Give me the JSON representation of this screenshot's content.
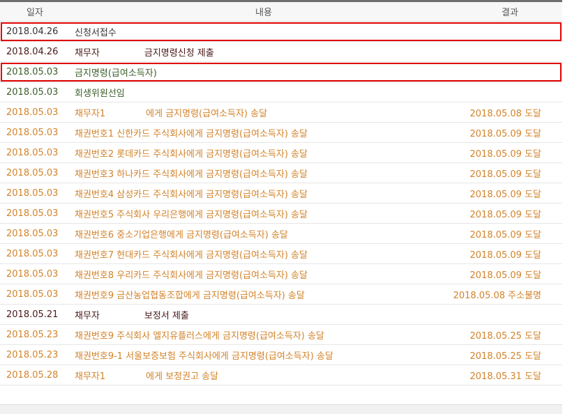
{
  "header": {
    "date": "일자",
    "content": "내용",
    "result": "결과"
  },
  "rows": [
    {
      "date": "2018.04.26",
      "party": "신청서접수",
      "text": "",
      "result": "",
      "color": "#333333",
      "highlighted": true
    },
    {
      "date": "2018.04.26",
      "party": "채무자",
      "text": "금지명령신청 제출",
      "result": "",
      "color": "#4a1818",
      "highlighted": false
    },
    {
      "date": "2018.05.03",
      "party": "금지명령(급여소득자)",
      "text": "",
      "result": "",
      "color": "#3b5e2a",
      "highlighted": true
    },
    {
      "date": "2018.05.03",
      "party": "회생위원선임",
      "text": "",
      "result": "",
      "color": "#3b5e2a",
      "highlighted": false
    },
    {
      "date": "2018.05.03",
      "party": "채무자1",
      "text": "에게 금지명령(급여소득자) 송달",
      "result": "2018.05.08 도달",
      "color": "#d2832a",
      "highlighted": false
    },
    {
      "date": "2018.05.03",
      "party": "채권번호1 신한카드 주식회사에게 금지명령(급여소득자) 송달",
      "text": "",
      "result": "2018.05.09 도달",
      "color": "#d2832a",
      "highlighted": false
    },
    {
      "date": "2018.05.03",
      "party": "채권번호2 롯데카드 주식회사에게 금지명령(급여소득자) 송달",
      "text": "",
      "result": "2018.05.09 도달",
      "color": "#d2832a",
      "highlighted": false
    },
    {
      "date": "2018.05.03",
      "party": "채권번호3 하나카드 주식회사에게 금지명령(급여소득자) 송달",
      "text": "",
      "result": "2018.05.09 도달",
      "color": "#d2832a",
      "highlighted": false
    },
    {
      "date": "2018.05.03",
      "party": "채권번호4 삼성카드 주식회사에게 금지명령(급여소득자) 송달",
      "text": "",
      "result": "2018.05.09 도달",
      "color": "#d2832a",
      "highlighted": false
    },
    {
      "date": "2018.05.03",
      "party": "채권번호5 주식회사 우리은행에게 금지명령(급여소득자) 송달",
      "text": "",
      "result": "2018.05.09 도달",
      "color": "#d2832a",
      "highlighted": false
    },
    {
      "date": "2018.05.03",
      "party": "채권번호6 중소기업은행에게 금지명령(급여소득자) 송달",
      "text": "",
      "result": "2018.05.09 도달",
      "color": "#d2832a",
      "highlighted": false
    },
    {
      "date": "2018.05.03",
      "party": "채권번호7 현대카드 주식회사에게 금지명령(급여소득자) 송달",
      "text": "",
      "result": "2018.05.09 도달",
      "color": "#d2832a",
      "highlighted": false
    },
    {
      "date": "2018.05.03",
      "party": "채권번호8 우리카드 주식회사에게 금지명령(급여소득자) 송달",
      "text": "",
      "result": "2018.05.09 도달",
      "color": "#d2832a",
      "highlighted": false
    },
    {
      "date": "2018.05.03",
      "party": "채권번호9 금산농업협동조합에게 금지명령(급여소득자) 송달",
      "text": "",
      "result": "2018.05.08 주소불명",
      "color": "#d2832a",
      "highlighted": false
    },
    {
      "date": "2018.05.21",
      "party": "채무자",
      "text": "보정서 제출",
      "result": "",
      "color": "#4a1818",
      "highlighted": false
    },
    {
      "date": "2018.05.23",
      "party": "채권번호9 주식회사 엘지유플러스에게 금지명령(급여소득자) 송달",
      "text": "",
      "result": "2018.05.25 도달",
      "color": "#d2832a",
      "highlighted": false
    },
    {
      "date": "2018.05.23",
      "party": "채권번호9-1 서울보증보험 주식회사에게 금지명령(급여소득자) 송달",
      "text": "",
      "result": "2018.05.25 도달",
      "color": "#d2832a",
      "highlighted": false
    },
    {
      "date": "2018.05.28",
      "party": "채무자1",
      "text": "에게 보정권고 송달",
      "result": "2018.05.31 도달",
      "color": "#d2832a",
      "highlighted": false
    }
  ]
}
